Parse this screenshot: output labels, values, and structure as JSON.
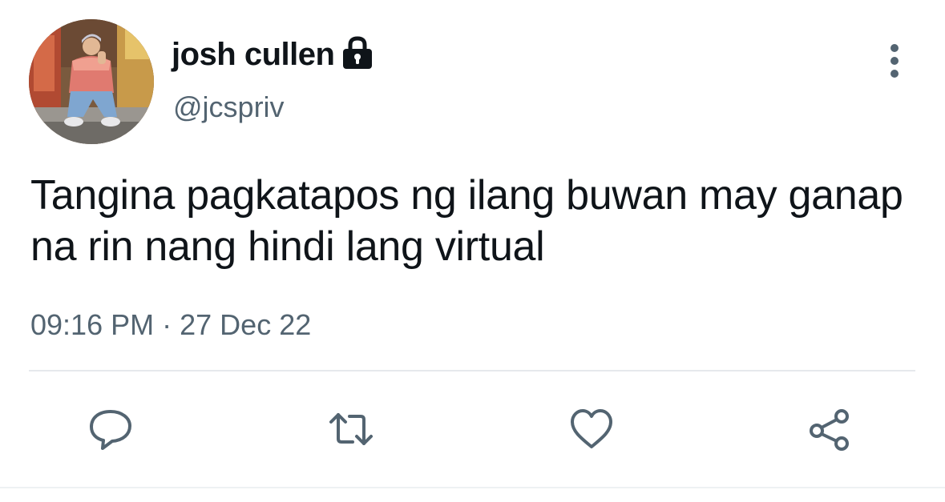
{
  "user": {
    "display_name": "josh cullen",
    "handle": "@jcspriv",
    "protected_icon": "lock-icon",
    "avatar": "profile-photo"
  },
  "tweet": {
    "text": "Tangina pagkatapos ng ilang buwan may ganap na rin nang hindi lang virtual",
    "time": "09:16 PM",
    "separator": "·",
    "date": "27 Dec 22"
  },
  "actions": [
    {
      "name": "reply",
      "icon": "speech-bubble-icon"
    },
    {
      "name": "retweet",
      "icon": "retweet-icon"
    },
    {
      "name": "like",
      "icon": "heart-icon"
    },
    {
      "name": "share",
      "icon": "share-icon"
    }
  ],
  "menu": {
    "icon": "more-vertical-icon"
  },
  "colors": {
    "text_primary": "#0f1419",
    "text_secondary": "#536471",
    "icon": "#536471",
    "divider": "#e6e9ec"
  }
}
